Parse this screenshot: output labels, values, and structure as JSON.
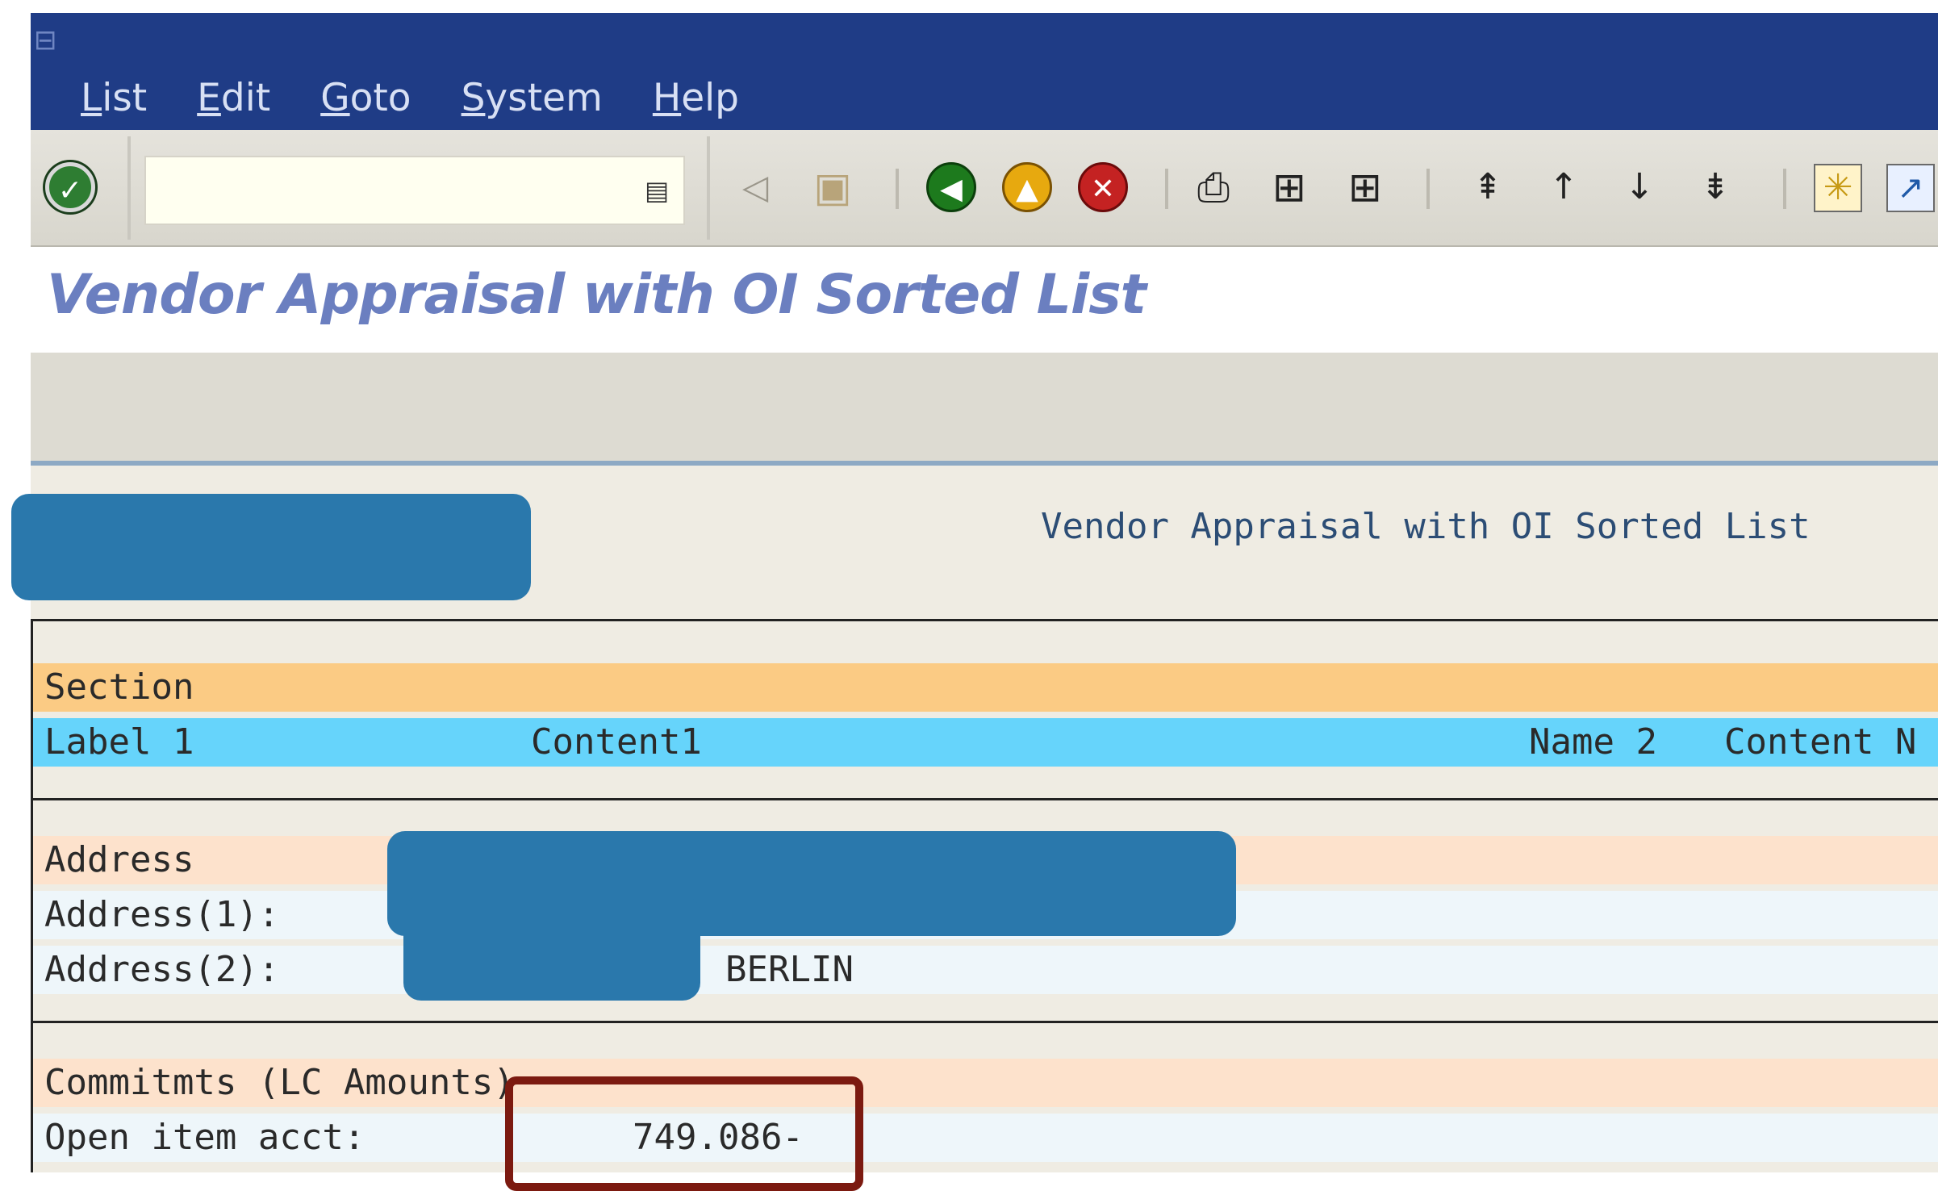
{
  "menubar": {
    "items": [
      {
        "label": "List",
        "mnemonic": "L",
        "rest": "ist"
      },
      {
        "label": "Edit",
        "mnemonic": "E",
        "rest": "dit"
      },
      {
        "label": "Goto",
        "mnemonic": "G",
        "rest": "oto"
      },
      {
        "label": "System",
        "mnemonic": "S",
        "rest": "ystem"
      },
      {
        "label": "Help",
        "mnemonic": "H",
        "rest": "elp"
      }
    ]
  },
  "toolbar": {
    "command_field_value": "",
    "icons": [
      "enter-icon",
      "back-triangle-icon",
      "save-icon",
      "back-icon",
      "exit-icon",
      "cancel-icon",
      "print-icon",
      "find-icon",
      "find-next-icon",
      "first-page-icon",
      "previous-page-icon",
      "next-page-icon",
      "last-page-icon",
      "create-session-icon",
      "shortcut-icon"
    ]
  },
  "page": {
    "title": "Vendor Appraisal with OI Sorted List"
  },
  "list": {
    "title": "Vendor Appraisal with OI Sorted List",
    "section_header": "Section",
    "columns": {
      "label1": "Label 1",
      "content1": "Content1",
      "name2": "Name 2",
      "content_n": "Content N"
    },
    "address": {
      "header": "Address",
      "line1_label": "Address(1):",
      "line2_label": "Address(2):",
      "line2_city": "BERLIN"
    },
    "commitments": {
      "header": "Commitmts (LC Amounts)",
      "open_item_label": "Open item acct:",
      "open_item_value": "749.086-"
    }
  },
  "colors": {
    "titlebar": "#1f3c86",
    "section_row": "#fbcb84",
    "column_row": "#66d4fb",
    "group_header": "#fde2cc",
    "redaction": "#2a78ac",
    "highlight_box": "#7c1a10"
  }
}
